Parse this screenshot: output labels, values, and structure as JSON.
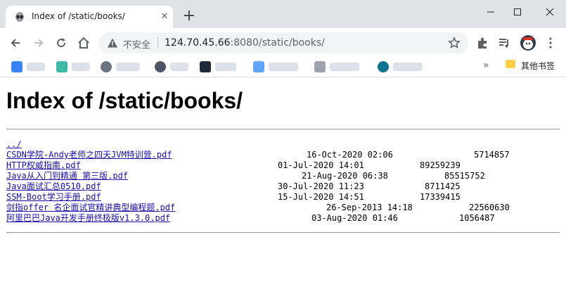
{
  "browser": {
    "tab_title": "Index of /static/books/",
    "insecure_label": "不安全",
    "url_host": "124.70.45.66",
    "url_rest": ":8080/static/books/",
    "other_bookmarks_label": "其他书签",
    "accent_color": "#1a73e8"
  },
  "page": {
    "title": "Index of /static/books/",
    "parent_link": "../",
    "files": [
      {
        "name": "CSDN学院-Andy老师之四天JVM特训营.pdf",
        "date": "16-Oct-2020 02:06",
        "size": "5714857"
      },
      {
        "name": "HTTP权威指南.pdf",
        "date": "01-Jul-2020 14:01",
        "size": "89259239"
      },
      {
        "name": "Java从入门到精通 第三版.pdf",
        "date": "21-Aug-2020 06:38",
        "size": "85515752"
      },
      {
        "name": "Java面试汇总0510.pdf",
        "date": "30-Jul-2020 11:23",
        "size": "8711425"
      },
      {
        "name": "SSM-Boot学习手册.pdf",
        "date": "15-Jul-2020 14:51",
        "size": "17339415"
      },
      {
        "name": "剑指offer 名企面试官精讲典型编程题.pdf",
        "date": "26-Sep-2013 14:18",
        "size": "22560630"
      },
      {
        "name": "阿里巴巴Java开发手册终极版v1.3.0.pdf",
        "date": "03-Aug-2020 01:46",
        "size": "1056487"
      }
    ]
  }
}
